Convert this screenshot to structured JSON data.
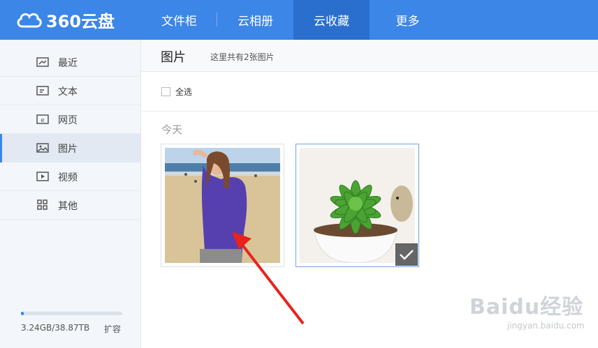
{
  "app": {
    "logo_text": "360云盘"
  },
  "nav": {
    "items": [
      {
        "label": "文件柜"
      },
      {
        "label": "云相册"
      },
      {
        "label": "云收藏"
      },
      {
        "label": "更多"
      }
    ],
    "active": "云收藏"
  },
  "sidebar": {
    "items": [
      {
        "label": "最近",
        "icon": "recent-icon"
      },
      {
        "label": "文本",
        "icon": "text-icon"
      },
      {
        "label": "网页",
        "icon": "web-icon"
      },
      {
        "label": "图片",
        "icon": "image-icon"
      },
      {
        "label": "视频",
        "icon": "video-icon"
      },
      {
        "label": "其他",
        "icon": "other-icon"
      }
    ],
    "active": "图片",
    "quota": {
      "text": "3.24GB/38.87TB",
      "used_fraction": 0.03
    },
    "expand_label": "扩容"
  },
  "main": {
    "title": "图片",
    "count_text": "这里共有2张图片",
    "select_all_label": "全选",
    "group_label": "今天",
    "photos": [
      {
        "name": "woman-on-beach",
        "selected": false
      },
      {
        "name": "succulent-plant",
        "selected": true
      }
    ]
  },
  "watermark": {
    "main": "Baidu经验",
    "sub": "jingyan.baidu.com"
  },
  "colors": {
    "accent": "#3b86e6",
    "nav_active": "#2a6fcd",
    "arrow": "#e8231c"
  }
}
